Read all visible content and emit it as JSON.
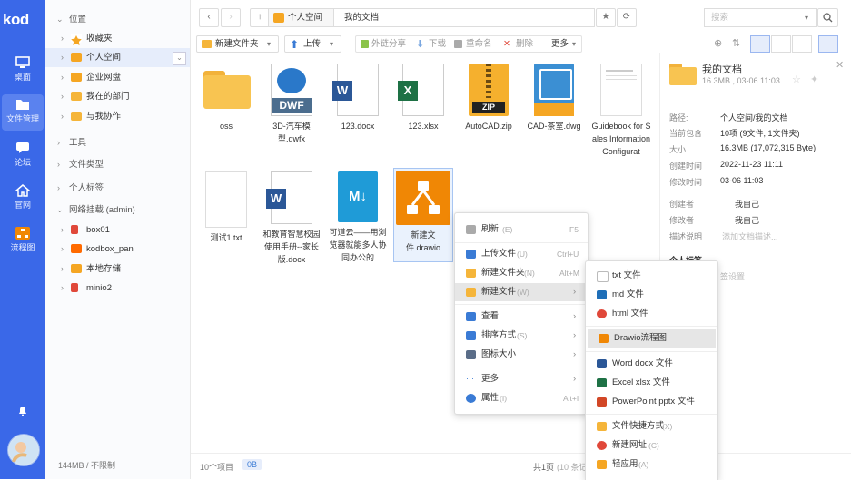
{
  "rail": {
    "logo": "kod",
    "items": [
      {
        "label": "桌面",
        "icon": "monitor-icon"
      },
      {
        "label": "文件管理",
        "icon": "folder-icon"
      },
      {
        "label": "论坛",
        "icon": "chat-icon"
      },
      {
        "label": "官网",
        "icon": "home-icon"
      },
      {
        "label": "流程图",
        "icon": "flowchart-icon"
      }
    ]
  },
  "tree": {
    "location": "位置",
    "favorites": "收藏夹",
    "personal_space": "个人空间",
    "enterprise_disk": "企业网盘",
    "my_dept": "我在的部门",
    "my_collab": "与我协作",
    "tools": "工具",
    "file_type": "文件类型",
    "personal_tags": "个人标签",
    "network_mount": "网络挂载 (admin)",
    "mounts": [
      "box01",
      "kodbox_pan",
      "本地存储",
      "minio2"
    ],
    "quota": "144MB / 不限制"
  },
  "breadcrumb": {
    "root": "个人空间",
    "current": "我的文档"
  },
  "search": {
    "placeholder": "搜索"
  },
  "toolbar": {
    "new_folder": "新建文件夹",
    "upload": "上传",
    "share": "外链分享",
    "download": "下载",
    "rename": "重命名",
    "delete": "删除",
    "more": "更多"
  },
  "files": [
    {
      "name": "oss",
      "type": "folder"
    },
    {
      "name": "3D-汽车模型.dwfx",
      "type": "dwf"
    },
    {
      "name": "123.docx",
      "type": "word"
    },
    {
      "name": "123.xlsx",
      "type": "excel"
    },
    {
      "name": "AutoCAD.zip",
      "type": "zip"
    },
    {
      "name": "CAD-茶室.dwg",
      "type": "dwg"
    },
    {
      "name": "Guidebook for Sales Information Configurat",
      "type": "doc"
    },
    {
      "name": "测试1.txt",
      "type": "txt"
    },
    {
      "name": "和教育智慧校园使用手册--家长版.docx",
      "type": "word"
    },
    {
      "name": "可道云——用浏览器就能多人协同办公的",
      "type": "md"
    },
    {
      "name": "新建文件.drawio",
      "type": "drawio"
    }
  ],
  "detail": {
    "title": "我的文档",
    "meta": "16.3MB , 03-06 11:03",
    "path_label": "路径:",
    "path": "个人空间/我的文档",
    "contains_label": "当前包含",
    "contains": "10项 (9文件, 1文件夹)",
    "size_label": "大小",
    "size": "16.3MB (17,072,315 Byte)",
    "created_label": "创建时间",
    "created": "2022-11-23 11:11",
    "modified_label": "修改时间",
    "modified": "03-06 11:03",
    "creator_label": "创建者",
    "creator": "我自己",
    "modifier_label": "修改者",
    "modifier": "我自己",
    "desc_label": "描述说明",
    "desc_placeholder": "添加文档描述...",
    "tags_label": "个人标签",
    "tags_setting": "签设置"
  },
  "status": {
    "count": "10个项目",
    "size": "0B",
    "total": "共1页",
    "perpage": "(10 条记"
  },
  "context_menu": {
    "items": [
      {
        "label": "刷新",
        "key": "(E)",
        "shortcut": "F5",
        "color": "#999"
      },
      {
        "label": "上传文件",
        "key": "(U)",
        "shortcut": "Ctrl+U",
        "color": "#3a7bd5"
      },
      {
        "label": "新建文件夹",
        "key": "(N)",
        "shortcut": "Alt+M",
        "color": "#f5b53a"
      },
      {
        "label": "新建文件",
        "key": "(W)",
        "shortcut": "",
        "color": "#f5b53a"
      },
      {
        "label": "查看",
        "key": "",
        "shortcut": "",
        "color": "#3a7bd5"
      },
      {
        "label": "排序方式",
        "key": "(S)",
        "shortcut": "",
        "color": "#3a7bd5"
      },
      {
        "label": "图标大小",
        "key": "",
        "shortcut": "",
        "color": "#3a7bd5"
      },
      {
        "label": "更多",
        "key": "",
        "shortcut": "",
        "color": "#3a7bd5"
      },
      {
        "label": "属性",
        "key": "(I)",
        "shortcut": "Alt+I",
        "color": "#3a7bd5"
      }
    ]
  },
  "submenu": {
    "items": [
      {
        "label": "txt 文件",
        "key": "",
        "color": "#aaa"
      },
      {
        "label": "md 文件",
        "key": "",
        "color": "#1f6fb8"
      },
      {
        "label": "html 文件",
        "key": "",
        "color": "#e0483a"
      },
      {
        "label": "Drawio流程图",
        "key": "",
        "color": "#f08705"
      },
      {
        "label": "Word docx 文件",
        "key": "",
        "color": "#2b5797"
      },
      {
        "label": "Excel xlsx 文件",
        "key": "",
        "color": "#1e7145"
      },
      {
        "label": "PowerPoint pptx 文件",
        "key": "",
        "color": "#d24726"
      },
      {
        "label": "文件快捷方式",
        "key": "(X)",
        "color": "#f5b53a"
      },
      {
        "label": "新建网址",
        "key": "(C)",
        "color": "#e0483a"
      },
      {
        "label": "轻应用",
        "key": "(A)",
        "color": "#f5a623"
      }
    ]
  }
}
